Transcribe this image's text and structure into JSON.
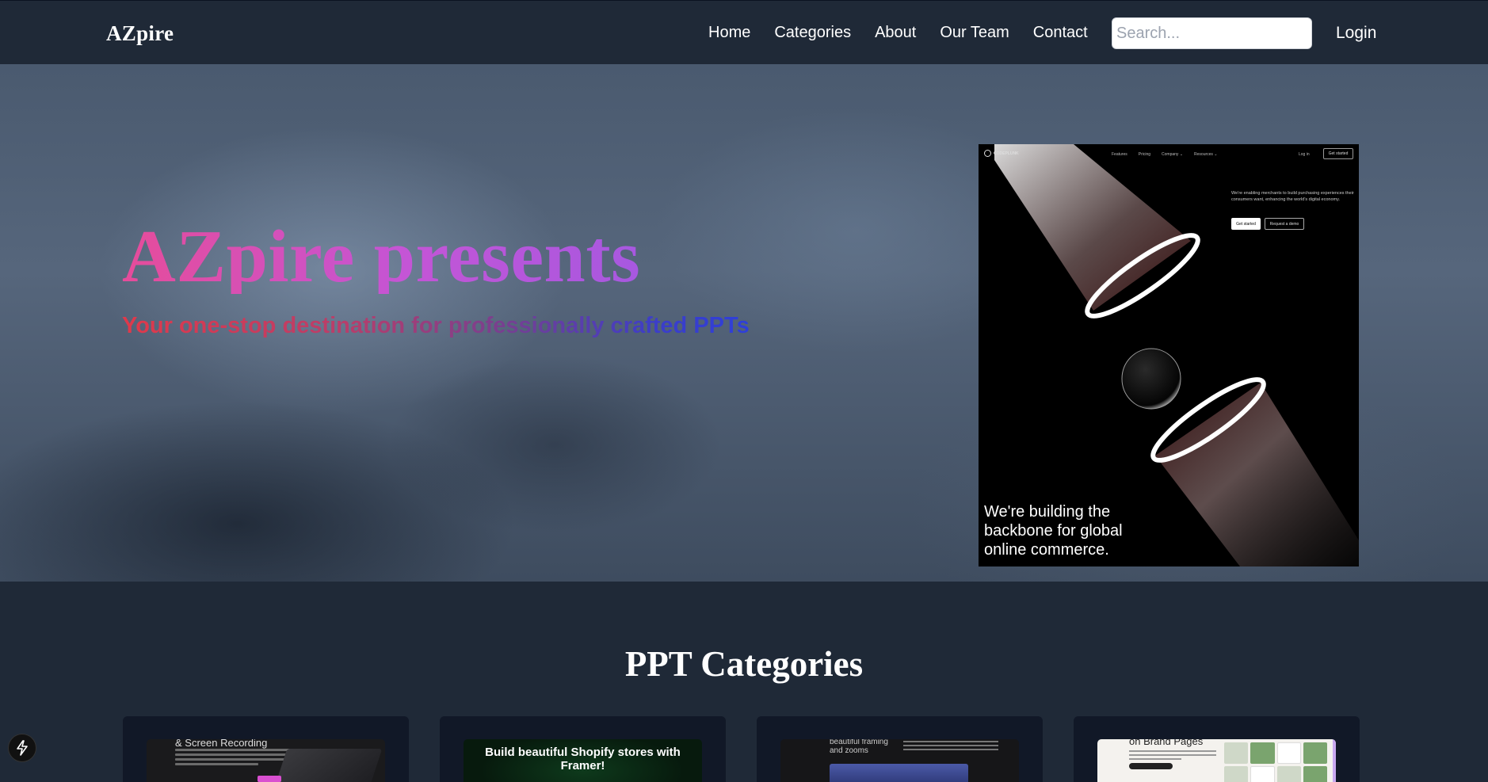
{
  "navbar": {
    "brand": "AZpire",
    "links": [
      "Home",
      "Categories",
      "About",
      "Our Team",
      "Contact"
    ],
    "search_placeholder": "Search...",
    "login": "Login"
  },
  "hero": {
    "title": "AZpire presents",
    "subtitle": "Your one-stop destination for professionally crafted PPTs",
    "preview": {
      "logo_text": "CODEPLUNK",
      "nav": [
        "Features",
        "Pricing",
        "Company ⌄",
        "Resources ⌄"
      ],
      "login": "Log in",
      "get_started": "Get started",
      "description": "We're enabling merchants to build purchasing experiences their consumers want, enhancing the world's digital economy.",
      "btn_primary": "Get started",
      "btn_secondary": "Request a demo",
      "tagline": "We're building the backbone for global online commerce."
    }
  },
  "categories": {
    "title": "PPT Categories",
    "cards": [
      {
        "thumb_text": "& Screen Recording"
      },
      {
        "thumb_text": "Build beautiful Shopify stores with Framer!"
      },
      {
        "thumb_text": "beautiful framing and zooms"
      },
      {
        "thumb_text": "on Brand Pages"
      }
    ]
  },
  "colors": {
    "navbar_bg": "#1f2937",
    "title_gradient_start": "#e64c9a",
    "title_gradient_end": "#a758e0",
    "subtitle_gradient_start": "#e0394a",
    "subtitle_gradient_end": "#2e3fd9"
  },
  "icons": {
    "floating_badge": "lightning-icon"
  }
}
